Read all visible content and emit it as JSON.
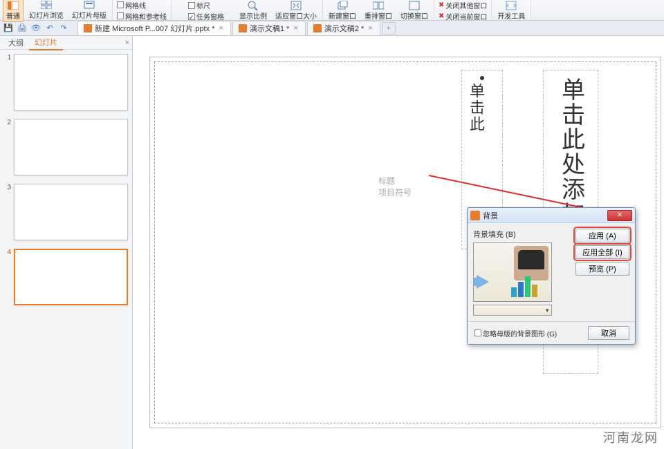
{
  "ribbon": {
    "view_normal": "普通",
    "view_browse": "幻灯片浏览",
    "view_master": "幻灯片母版",
    "grid_lines": "网格线",
    "grid_guides": "网格和参考线",
    "ruler": "标尺",
    "task_pane": "任务窗格",
    "zoom": "显示比例",
    "fit": "适应窗口大小",
    "new_window": "新建窗口",
    "arrange": "重排窗口",
    "switch": "切换窗口",
    "close_other": "关闭其他窗口",
    "close_current": "关闭当前窗口",
    "dev_tools": "开发工具"
  },
  "tabs": [
    {
      "label": "新建 Microsoft P...007 幻灯片.pptx *"
    },
    {
      "label": "演示文稿1 *"
    },
    {
      "label": "演示文稿2 *"
    }
  ],
  "sidepane": {
    "outline": "大纲",
    "slides": "幻灯片",
    "items": [
      "1",
      "2",
      "3",
      "4"
    ]
  },
  "slide": {
    "title_placeholder": "单击此处添加标题",
    "body_placeholder": "单击此",
    "faded1": "标题",
    "faded2": "项目符号"
  },
  "dialog": {
    "title": "背景",
    "fill_group": "背景填充 (B)",
    "apply": "应用 (A)",
    "apply_all": "应用全部 (I)",
    "preview": "预览 (P)",
    "cancel": "取消",
    "omit_master": "忽略母版的背景图形 (G)"
  },
  "watermark": "河南龙网"
}
